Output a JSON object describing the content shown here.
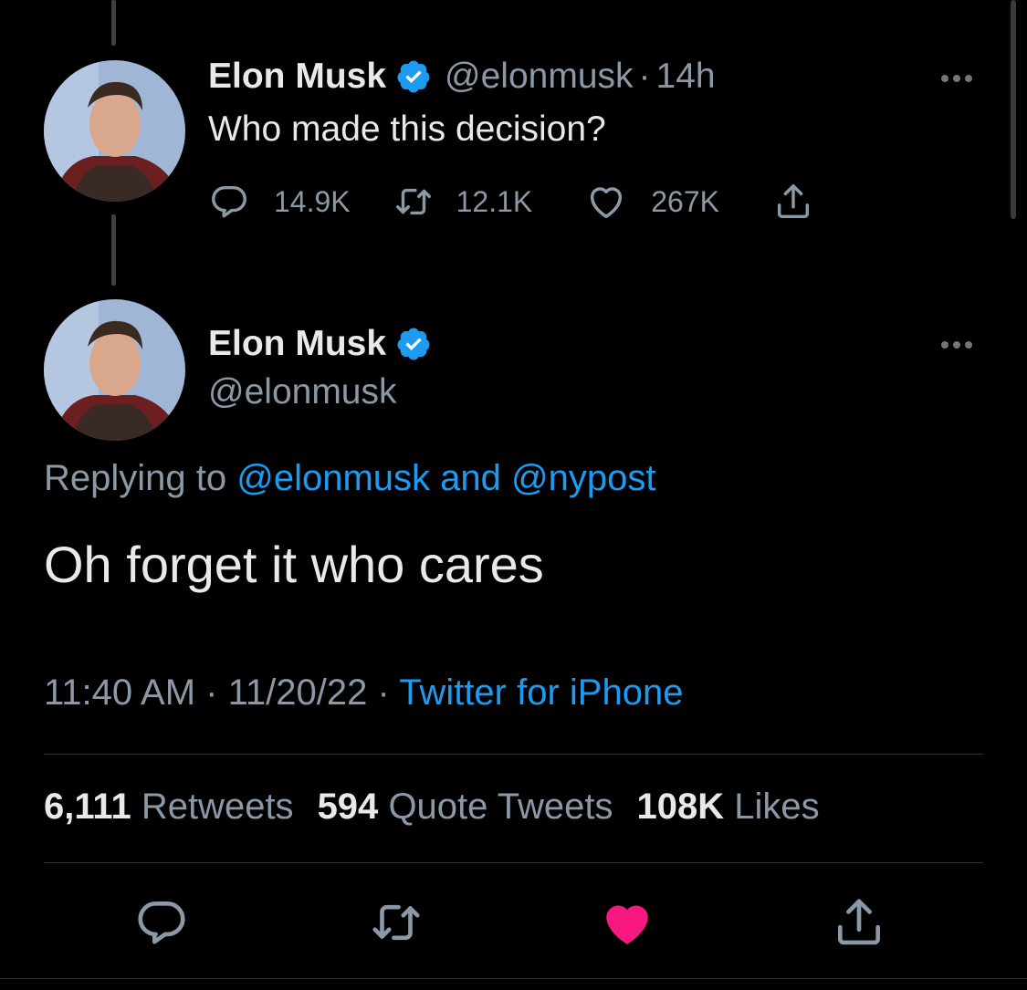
{
  "parent_tweet": {
    "author_name": "Elon Musk",
    "handle": "@elonmusk",
    "separator": "·",
    "time_ago": "14h",
    "text": "Who made this decision?",
    "reply_count": "14.9K",
    "retweet_count": "12.1K",
    "like_count": "267K"
  },
  "main_tweet": {
    "author_name": "Elon Musk",
    "handle": "@elonmusk",
    "replying_prefix": "Replying to",
    "replying_to": "@elonmusk and @nypost",
    "text": "Oh forget it who cares",
    "time": "11:40 AM",
    "separator": "·",
    "date": "11/20/22",
    "source": "Twitter for iPhone",
    "stats": {
      "retweets_value": "6,111",
      "retweets_label": "Retweets",
      "quotes_value": "594",
      "quotes_label": "Quote Tweets",
      "likes_value": "108K",
      "likes_label": "Likes"
    }
  },
  "colors": {
    "background": "#000000",
    "text_primary": "#e7e9ea",
    "text_secondary": "#8b98a5",
    "link": "#1d9bf0",
    "verified": "#1d9bf0",
    "liked": "#f91880"
  },
  "icons": {
    "reply": "speech-bubble-icon",
    "retweet": "retweet-arrows-icon",
    "like": "heart-icon",
    "share": "share-upload-icon",
    "more": "more-dots-icon",
    "verified": "verified-badge-icon"
  }
}
